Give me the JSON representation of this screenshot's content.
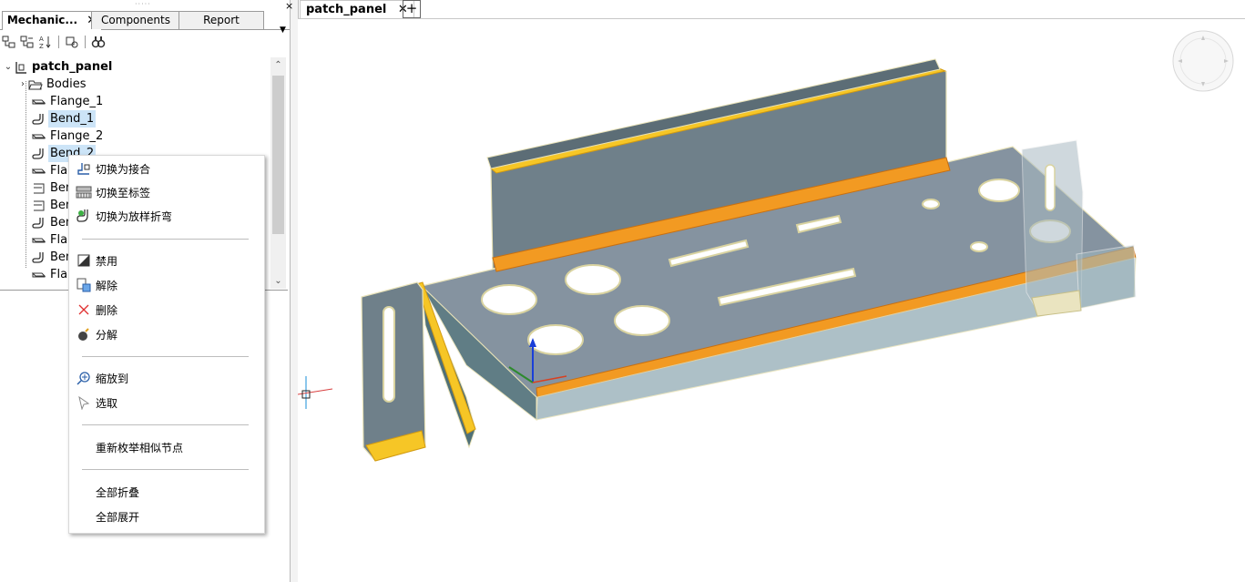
{
  "panel": {
    "tabs": [
      {
        "label": "Mechanic...",
        "close": "✕"
      },
      {
        "label": "Components"
      },
      {
        "label": "Report"
      }
    ],
    "grip": "·····",
    "close_glyph": "×",
    "menu_glyph": "▼"
  },
  "toolbar": {
    "icons": [
      "tree-collapse-icon",
      "tree-expand-icon",
      "sort-az-icon",
      "settings-icon",
      "find-icon"
    ]
  },
  "tree": {
    "root": "patch_panel",
    "items": [
      {
        "label": "Bodies",
        "icon": "folder-icon"
      },
      {
        "label": "Flange_1",
        "icon": "flange-icon"
      },
      {
        "label": "Bend_1",
        "icon": "bend-icon"
      },
      {
        "label": "Flange_2",
        "icon": "flange-icon"
      },
      {
        "label": "Bend_2",
        "icon": "bend-icon"
      },
      {
        "label": "Flan",
        "icon": "flange-icon"
      },
      {
        "label": "Ben",
        "icon": "junction-icon"
      },
      {
        "label": "Ben",
        "icon": "junction-icon"
      },
      {
        "label": "Ben",
        "icon": "bend-icon"
      },
      {
        "label": "Flan",
        "icon": "flange-icon"
      },
      {
        "label": "Ben",
        "icon": "bend-icon"
      },
      {
        "label": "Flan",
        "icon": "flange-icon"
      }
    ]
  },
  "context_menu": {
    "items": [
      {
        "label": "切换为接合",
        "icon": "junction-icon"
      },
      {
        "label": "切换至标签",
        "icon": "label-icon"
      },
      {
        "label": "切换为放样折弯",
        "icon": "loft-bend-icon"
      },
      {
        "label": "禁用",
        "icon": "disable-icon"
      },
      {
        "label": "解除",
        "icon": "release-icon"
      },
      {
        "label": "删除",
        "icon": "delete-icon"
      },
      {
        "label": "分解",
        "icon": "explode-icon"
      },
      {
        "label": "缩放到",
        "icon": "zoom-to-icon"
      },
      {
        "label": "选取",
        "icon": "select-icon"
      },
      {
        "label": "重新枚举相似节点"
      },
      {
        "label": "全部折叠"
      },
      {
        "label": "全部展开"
      }
    ]
  },
  "document": {
    "tab_label": "patch_panel",
    "tab_close": "✕",
    "add_tab": "+"
  },
  "colors": {
    "body": "#6e7f89",
    "body_dark": "#4f7078",
    "bend_yellow": "#f6c626",
    "bend_orange": "#f29a22",
    "edge": "#e8e2b8",
    "selection": "#cce4f7"
  }
}
